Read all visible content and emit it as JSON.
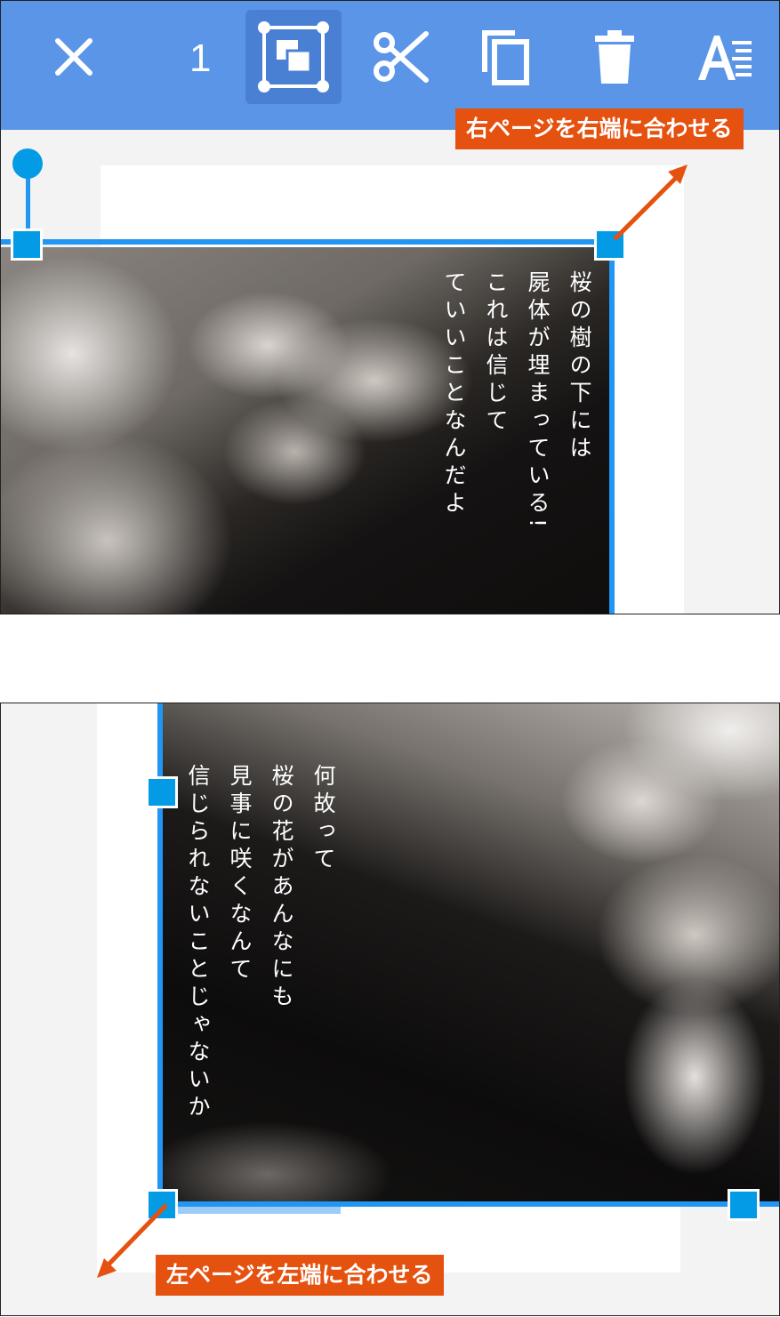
{
  "toolbar": {
    "close_icon": "close-icon",
    "selection_count": "1",
    "fit_page_icon": "fit-page-icon",
    "cut_icon": "scissors-icon",
    "copy_icon": "copy-icon",
    "delete_icon": "trash-icon",
    "text_icon": "text-format-icon"
  },
  "top_page": {
    "text_lines": [
      "桜の樹の下には",
      "屍体が埋まっている!",
      "これは信じて",
      "ていいことなんだよ"
    ],
    "callout": "右ページを右端に合わせる"
  },
  "bottom_page": {
    "text_lines": [
      "何故って",
      "桜の花があんなにも",
      "見事に咲くなんて",
      "信じられないことじゃないか"
    ],
    "callout": "左ページを左端に合わせる"
  },
  "colors": {
    "toolbar": "#5a95e8",
    "selection": "#2196f3",
    "handle": "#039be5",
    "callout": "#e5510f"
  }
}
